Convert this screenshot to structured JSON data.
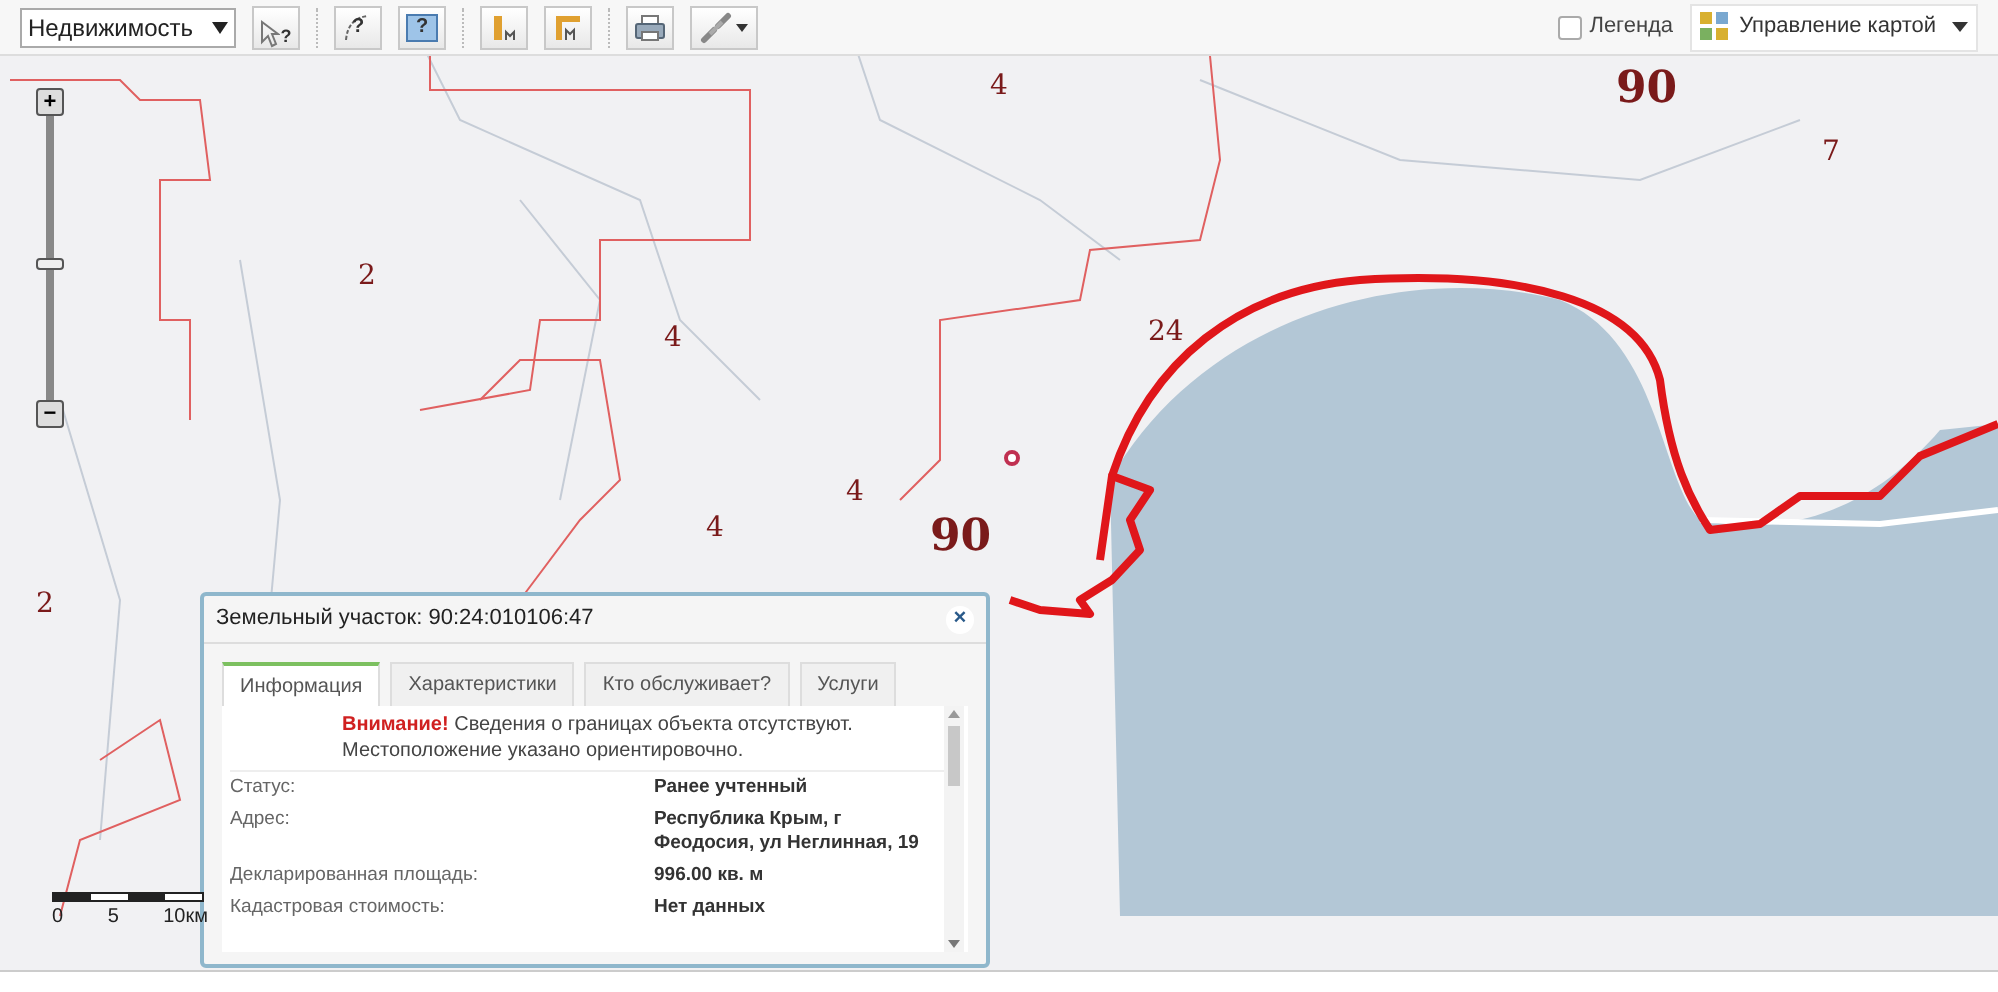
{
  "toolbar": {
    "layer_select": "Недвижимость",
    "pointer_help": "?",
    "polyline_help": "?",
    "polygon_help": "?",
    "legend": {
      "label": "Легенда",
      "checked": false
    },
    "map_control": "Управление картой"
  },
  "zoom": {
    "plus": "+",
    "minus": "−",
    "level": 0.48
  },
  "map_labels": [
    {
      "text": "4",
      "kind": "district"
    },
    {
      "text": "90",
      "kind": "region"
    },
    {
      "text": "7",
      "kind": "district"
    },
    {
      "text": "2",
      "kind": "district"
    },
    {
      "text": "4",
      "kind": "district"
    },
    {
      "text": "24",
      "kind": "district"
    },
    {
      "text": "4",
      "kind": "district"
    },
    {
      "text": "4",
      "kind": "district"
    },
    {
      "text": "90",
      "kind": "region"
    },
    {
      "text": "2",
      "kind": "district"
    }
  ],
  "scale_bar": [
    "0",
    "5",
    "10км"
  ],
  "popup": {
    "title": "Земельный участок: 90:24:010106:47",
    "close": "×",
    "tabs": [
      {
        "label": "Информация",
        "selected": true
      },
      {
        "label": "Характеристики",
        "selected": false
      },
      {
        "label": "Кто обслуживает?",
        "selected": false
      },
      {
        "label": "Услуги",
        "selected": false
      }
    ],
    "warning": "**Внимание!** Сведения о границах объекта отсутствуют. Местоположение указано ориентировочно.",
    "rows": [
      {
        "label": "Статус:",
        "value": "Ранее учтенный"
      },
      {
        "label": "Адрес:",
        "value": "Республика Крым, г Феодосия, ул Неглинная, 19"
      },
      {
        "label": "Декларированная площадь:",
        "value": "996.00 кв. м"
      },
      {
        "label": "Кадастровая стоимость:",
        "value": "Нет данных"
      }
    ]
  }
}
